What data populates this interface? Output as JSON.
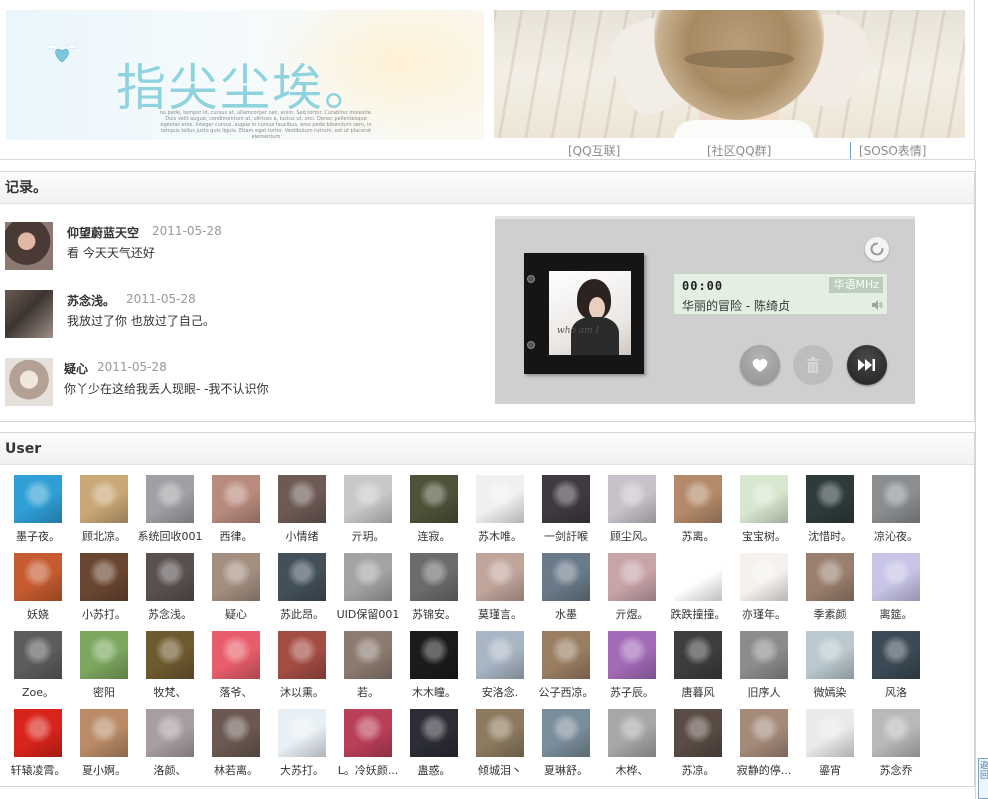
{
  "banner": {
    "title": "指尖尘埃。",
    "caption": "nu pede, tempor id, cursus at, ullamcorper nec, enim. Sed tortor. Curabitur molestie. Duis velit augue, condimentum at, ultrices a, luctus ut, orci. Donec pellentesque egestas eros. Integer cursus, augue in cursus faucibus, eros pede bibendum sem, in tempus tellus justo quis ligula. Etiam eget tortor. Vestibulum rutrum, est ut placerat elementum",
    "links": [
      "[QQ互联]",
      "[社区QQ群]",
      "[SOSO表情]"
    ]
  },
  "records": {
    "title": "记录。",
    "items": [
      {
        "name": "仰望蔚蓝天空",
        "date": "2011-05-28",
        "message": "看  今天天气还好"
      },
      {
        "name": "苏念浅。",
        "date": "2011-05-28",
        "message": "我放过了你  也放过了自己。"
      },
      {
        "name": "疑心",
        "date": "2011-05-28",
        "message": "你丫少在这给我丢人现眼- -我不认识你"
      }
    ]
  },
  "player": {
    "time": "00:00",
    "channel": "华语MHz",
    "song": "华丽的冒险 - 陈绮贞",
    "cover_script": "who am I"
  },
  "users": {
    "title": "User",
    "rows": [
      [
        "墨子夜。",
        "顾北凉。",
        "系统回收001",
        "西律。",
        "小情绪",
        "亓玥。",
        "连寂。",
        "苏木唯。",
        "一剑訏喉",
        "顾尘风。",
        "苏离。",
        "宝宝树。",
        "沈惜时。",
        "凉沁夜。"
      ],
      [
        "妖娆",
        "小苏打。",
        "苏念浅。",
        "疑心",
        "苏此昂。",
        "UID保留001",
        "苏锦安。",
        "莫瑾言。",
        "水墨",
        "亓煜。",
        "跌跌撞撞。",
        "亦瑾年。",
        "季素颜",
        "离筵。"
      ],
      [
        "Zoe。",
        "密阳",
        "牧梵、",
        "落爷、",
        "沐以熏。",
        "若。",
        "木木瞳。",
        "安洛念.",
        "公子西凉。",
        "苏子辰。",
        "唐暮风",
        "旧序人",
        "微嫣染",
        "风洛"
      ],
      [
        "轩辕凌霄。",
        "夏小婀。",
        "洛颜、",
        "林若离。",
        "大苏打。",
        "L。冷妖颜...",
        "蛊惑。",
        "倾城泪丶",
        "夏琳舒。",
        "木桦、",
        "苏凉。",
        "寂静的停...",
        "鎏宵",
        "苏念乔"
      ]
    ],
    "colors": [
      [
        "#2f9fd6",
        "#c9a777",
        "#9fa0a3",
        "#b98b7e",
        "#6c5a54",
        "#c8c8c8",
        "#4d5238",
        "#f0f0f0",
        "#3f3a40",
        "#c7c2ca",
        "#b48a6a",
        "#d7e6cf",
        "#2d3b3a",
        "#8b8e90"
      ],
      [
        "#c55b2f",
        "#6a4632",
        "#5a5050",
        "#a38f80",
        "#42505a",
        "#a3a3a3",
        "#6d6c6a",
        "#c0a59a",
        "#6a7a88",
        "#c8a4a9",
        "#ffffff",
        "#f5f2ee",
        "#9a7f6e",
        "#c7c4e6"
      ],
      [
        "#5c5c5c",
        "#7da75f",
        "#6e5a2f",
        "#e85d6b",
        "#a44d44",
        "#8c7b70",
        "#1b1b1b",
        "#a8b5c4",
        "#9a7e62",
        "#a36bb7",
        "#3d3d3d",
        "#8c8c8c",
        "#b9c9cf",
        "#3b4a55"
      ],
      [
        "#d9241c",
        "#ba8b66",
        "#a89ea2",
        "#6b5951",
        "#e9f0f5",
        "#ba3f58",
        "#2c2d35",
        "#8c7b5f",
        "#7a8d9a",
        "#a7a7a7",
        "#5a4b44",
        "#a58a7a",
        "#eaeaea",
        "#b9b9b9"
      ]
    ]
  },
  "corner_widget": {
    "label": "返回"
  }
}
